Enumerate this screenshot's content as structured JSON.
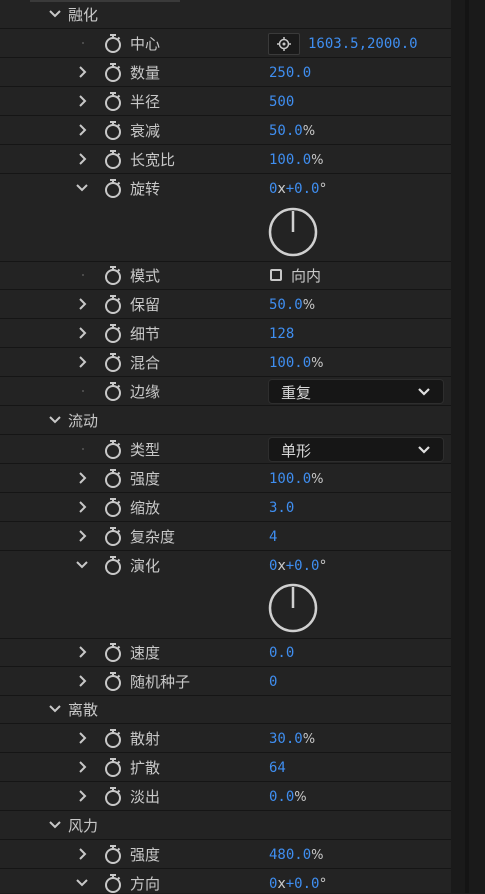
{
  "sections": {
    "dissolve": {
      "label": "融化"
    },
    "flow": {
      "label": "流动"
    },
    "scatter": {
      "label": "离散"
    },
    "wind": {
      "label": "风力"
    }
  },
  "dissolve": {
    "center": {
      "label": "中心",
      "value": "1603.5,2000.0"
    },
    "amount": {
      "label": "数量",
      "value": "250.0"
    },
    "radius": {
      "label": "半径",
      "value": "500"
    },
    "falloff": {
      "label": "衰减",
      "value": "50.0",
      "unit": "%"
    },
    "aspect": {
      "label": "长宽比",
      "value": "100.0",
      "unit": "%"
    },
    "rotation": {
      "label": "旋转",
      "revolutions": "0",
      "x": "x",
      "degrees": "+0.0",
      "deg_sign": "°"
    },
    "mode": {
      "label": "模式",
      "checkbox_label": "向内",
      "checked": false
    },
    "preserve": {
      "label": "保留",
      "value": "50.0",
      "unit": "%"
    },
    "detail": {
      "label": "细节",
      "value": "128"
    },
    "blend": {
      "label": "混合",
      "value": "100.0",
      "unit": "%"
    },
    "edge": {
      "label": "边缘",
      "selected": "重复"
    }
  },
  "flow": {
    "type": {
      "label": "类型",
      "selected": "单形"
    },
    "strength": {
      "label": "强度",
      "value": "100.0",
      "unit": "%"
    },
    "scale": {
      "label": "缩放",
      "value": "3.0"
    },
    "complexity": {
      "label": "复杂度",
      "value": "4"
    },
    "evolution": {
      "label": "演化",
      "revolutions": "0",
      "x": "x",
      "degrees": "+0.0",
      "deg_sign": "°"
    },
    "speed": {
      "label": "速度",
      "value": "0.0"
    },
    "seed": {
      "label": "随机种子",
      "value": "0"
    }
  },
  "scatter": {
    "scatter": {
      "label": "散射",
      "value": "30.0",
      "unit": "%"
    },
    "spread": {
      "label": "扩散",
      "value": "64"
    },
    "fade": {
      "label": "淡出",
      "value": "0.0",
      "unit": "%"
    }
  },
  "wind": {
    "strength": {
      "label": "强度",
      "value": "480.0",
      "unit": "%"
    },
    "direction": {
      "label": "方向",
      "revolutions": "0",
      "x": "x",
      "degrees": "+0.0",
      "deg_sign": "°"
    }
  },
  "colors": {
    "value_blue": "#3f8ef0",
    "panel_bg": "#232323",
    "text": "#c8c8c8"
  },
  "icons": {
    "stopwatch": "stopwatch-icon",
    "twirl_closed": "chevron-right-icon",
    "twirl_open": "chevron-down-icon",
    "point": "crosshair-icon",
    "dropdown": "chevron-down-icon"
  }
}
